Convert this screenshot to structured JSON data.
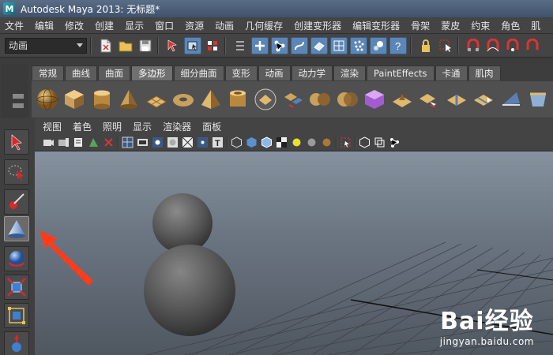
{
  "window": {
    "title": "Autodesk Maya 2013: 无标题*",
    "logo_letter": "M"
  },
  "menubar": [
    "文件",
    "编辑",
    "修改",
    "创建",
    "显示",
    "窗口",
    "资源",
    "动画",
    "几何缓存",
    "创建变形器",
    "编辑变形器",
    "骨架",
    "蒙皮",
    "约束",
    "角色",
    "肌"
  ],
  "statusline": {
    "mode_value": "动画"
  },
  "shelf": {
    "tabs": [
      "常规",
      "曲线",
      "曲面",
      "多边形",
      "细分曲面",
      "变形",
      "动画",
      "动力学",
      "渲染",
      "PaintEffects",
      "卡通",
      "肌肉"
    ],
    "active_tab": "多边形"
  },
  "panel": {
    "menus": [
      "视图",
      "着色",
      "照明",
      "显示",
      "渲染器",
      "面板"
    ],
    "text_tool_glyph": "T"
  },
  "toolbox": {
    "highlighted_tool": "poly-cone-tool"
  },
  "annotation": {
    "arrow_color": "#ff3b1a"
  },
  "watermark": {
    "logo": "Bai经验",
    "url": "jingyan.baidu.com"
  },
  "colors": {
    "titlebar": "#4a5c76",
    "viewport_top": "#86929f",
    "viewport_bottom": "#4f5760",
    "active_tab": "#707070"
  }
}
